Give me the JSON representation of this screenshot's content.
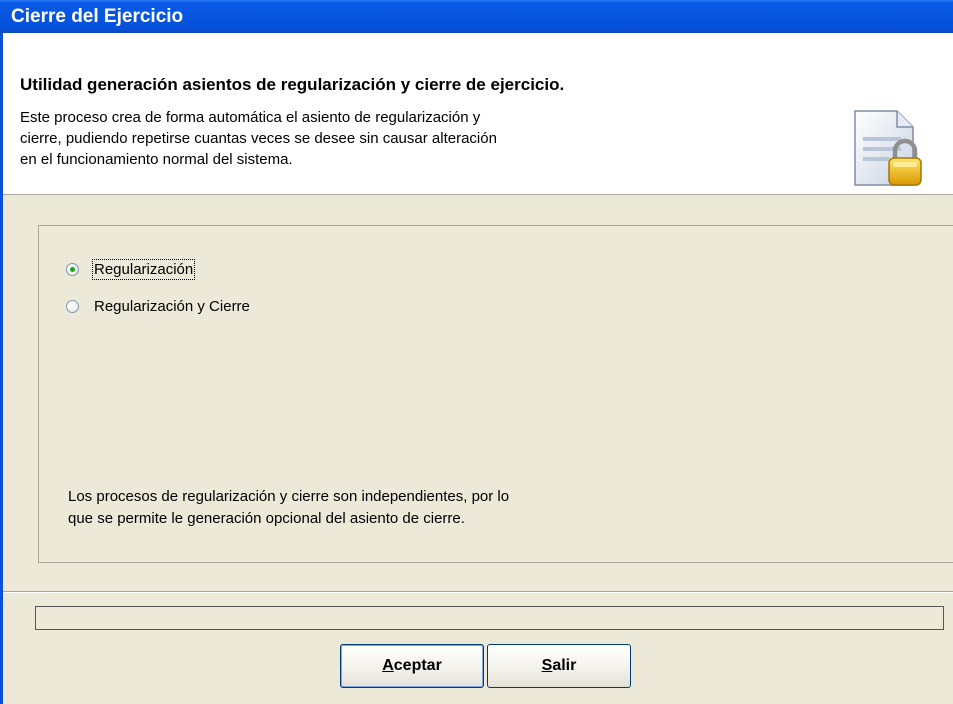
{
  "window": {
    "title": "Cierre del Ejercicio"
  },
  "header": {
    "title": "Utilidad generación asientos de regularización y cierre de ejercicio.",
    "description_lines": [
      "Este proceso crea de forma automática el asiento de regularización y",
      "cierre, pudiendo repetirse cuantas veces se desee sin causar alteración",
      "en el funcionamiento normal del sistema."
    ],
    "icon": "document-lock-icon"
  },
  "options": {
    "selected": "Regularización",
    "items": [
      {
        "label": "Regularización",
        "checked": true
      },
      {
        "label": "Regularización y Cierre",
        "checked": false
      }
    ]
  },
  "note_lines": [
    "Los procesos de regularización y cierre son independientes, por lo",
    "que se permite le generación opcional del asiento de cierre."
  ],
  "progress": {
    "value": 0
  },
  "buttons": {
    "accept": {
      "accel": "A",
      "rest": "ceptar"
    },
    "exit": {
      "accel": "S",
      "rest": "alir"
    }
  },
  "colors": {
    "titlebar": "#0756E0",
    "face": "#ECE9D8",
    "radio_dot": "#21A121"
  }
}
